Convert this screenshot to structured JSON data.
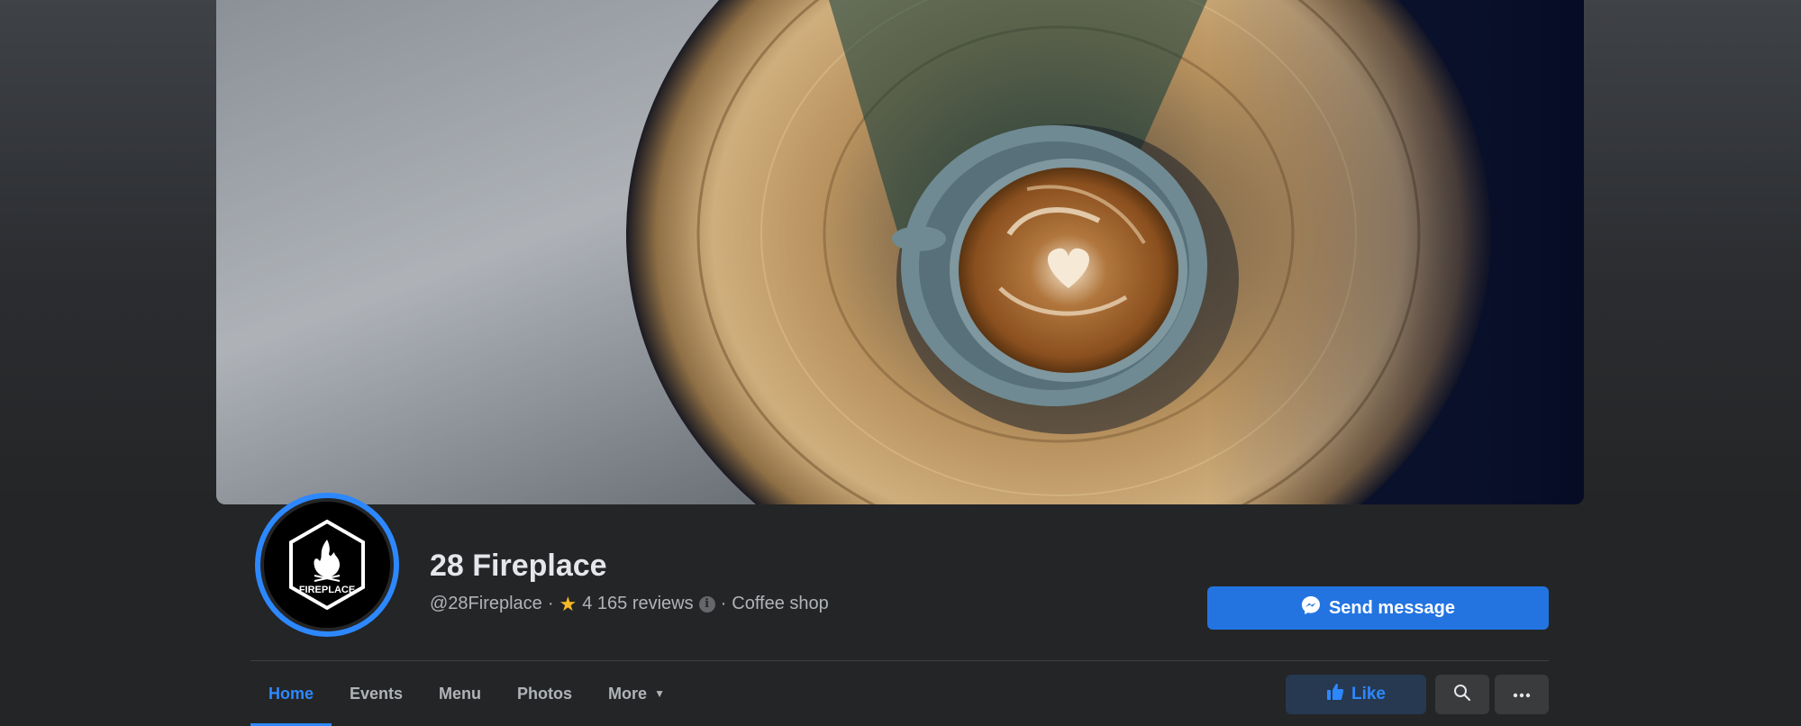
{
  "page": {
    "name": "28 Fireplace",
    "handle": "@28Fireplace",
    "separator": "·",
    "reviews": "4 165 reviews",
    "info_glyph": "i",
    "category": "Coffee shop",
    "avatar_logo_text": "FIREPLACE"
  },
  "actions": {
    "send_message": "Send message",
    "like": "Like",
    "search_icon": "search-icon",
    "more_icon": "ellipsis-icon"
  },
  "tabs": [
    {
      "label": "Home",
      "active": true
    },
    {
      "label": "Events",
      "active": false
    },
    {
      "label": "Menu",
      "active": false
    },
    {
      "label": "Photos",
      "active": false
    },
    {
      "label": "More",
      "active": false
    }
  ],
  "colors": {
    "accent": "#2d88ff",
    "primary_button": "#2374e1",
    "star": "#f7b928",
    "background": "#242526"
  }
}
